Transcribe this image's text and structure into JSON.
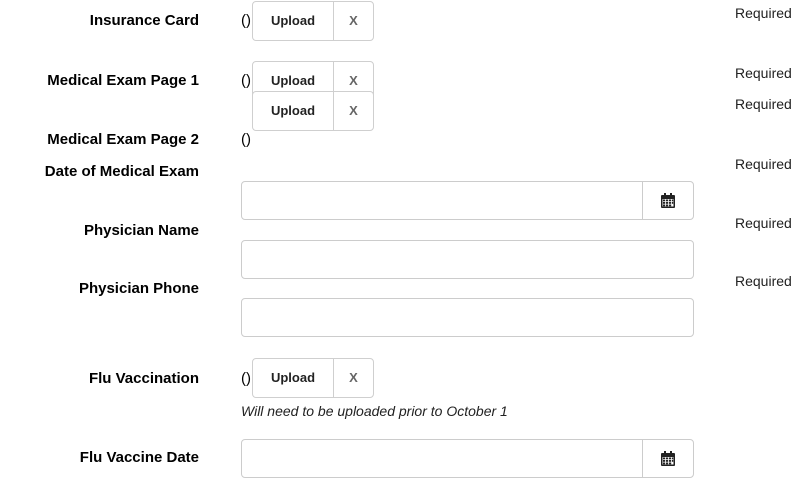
{
  "fields": {
    "insurance_card": {
      "label": "Insurance Card",
      "file_value": "()",
      "upload_label": "Upload",
      "remove_label": "X",
      "required_text": "Required"
    },
    "medical_exam_page_1": {
      "label": "Medical Exam Page 1",
      "file_value": "()",
      "upload_label": "Upload",
      "remove_label": "X",
      "required_text": "Required"
    },
    "medical_exam_page_2": {
      "label": "Medical Exam Page 2",
      "file_value": "()",
      "upload_label": "Upload",
      "remove_label": "X",
      "required_text": "Required"
    },
    "date_of_medical_exam": {
      "label": "Date of Medical Exam",
      "value": "",
      "icon": "calendar-icon",
      "required_text": "Required"
    },
    "physician_name": {
      "label": "Physician Name",
      "value": "",
      "required_text": "Required"
    },
    "physician_phone": {
      "label": "Physician Phone",
      "value": "",
      "required_text": "Required"
    },
    "flu_vaccination": {
      "label": "Flu Vaccination",
      "file_value": "()",
      "upload_label": "Upload",
      "remove_label": "X",
      "note": "Will need to be uploaded prior to October 1"
    },
    "flu_vaccine_date": {
      "label": "Flu Vaccine Date",
      "value": "",
      "icon": "calendar-icon"
    }
  }
}
